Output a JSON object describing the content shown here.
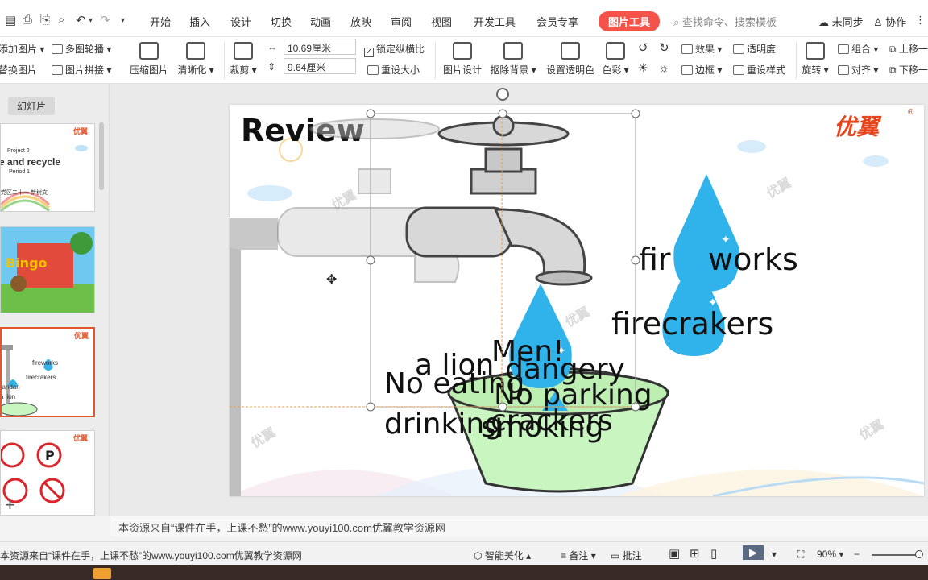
{
  "menubar": {
    "tabs": [
      "开始",
      "插入",
      "设计",
      "切换",
      "动画",
      "放映",
      "审阅",
      "视图",
      "开发工具",
      "会员专享"
    ],
    "active_tab": "图片工具",
    "search_placeholder": "查找命令、搜索模板",
    "sync": "未同步",
    "collab": "协作"
  },
  "ribbon": {
    "add_image": "添加图片",
    "multi_carousel": "多图轮播",
    "replace_image": "替换图片",
    "image_collage": "图片拼接",
    "compress": "压缩图片",
    "sharpen": "清晰化",
    "crop": "裁剪",
    "width_value": "10.69厘米",
    "height_value": "9.64厘米",
    "lock_ratio": "锁定纵横比",
    "reset_size": "重设大小",
    "image_design": "图片设计",
    "remove_bg": "抠除背景",
    "set_transparent": "设置透明色",
    "color": "色彩",
    "effects": "效果",
    "transparency": "透明度",
    "border": "边框",
    "reset_style": "重设样式",
    "rotate": "旋转",
    "group": "组合",
    "align": "对齐",
    "move_up": "上移一",
    "move_down": "下移一"
  },
  "left_panel": {
    "title": "幻灯片",
    "thumb1": {
      "line1": "Project 2",
      "line2": "e and recycle",
      "line3": "Period 1",
      "line4": "党区二十一   新树文"
    },
    "thumb3": {
      "w1": "fireworks",
      "w2": "firecrakers",
      "w3": "dandan",
      "w4": "a lion"
    }
  },
  "slide": {
    "heading": "Review",
    "logo": "优翼",
    "logo_reg": "®",
    "watermark": "优翼",
    "word_fireworks_a": "fir",
    "word_fireworks_b": "works",
    "word_firecrakers": "firecrakers",
    "cluster_a_lion": "a lion",
    "cluster_dangerous": "dangery",
    "cluster_no_eating": "No eating",
    "cluster_drinking": "drinking",
    "cluster_smoking": "smoking",
    "cluster_no_parking": "No parking",
    "cluster_crackers": "crackers",
    "cluster_men": "Men!"
  },
  "notes_text": "本资源来自“课件在手，上课不愁”的www.youyi100.com优翼教学资源网",
  "statusbar": {
    "left_text": "本资源来自“课件在手，上课不愁”的www.youyi100.com优翼教学资源网",
    "smart_beautify": "智能美化",
    "notes": "备注",
    "comments": "批注",
    "zoom": "90%"
  },
  "colors": {
    "accent": "#f5524a",
    "selection": "#e4572e",
    "drop": "#2fb3ea",
    "basin": "#c9f5c0"
  }
}
